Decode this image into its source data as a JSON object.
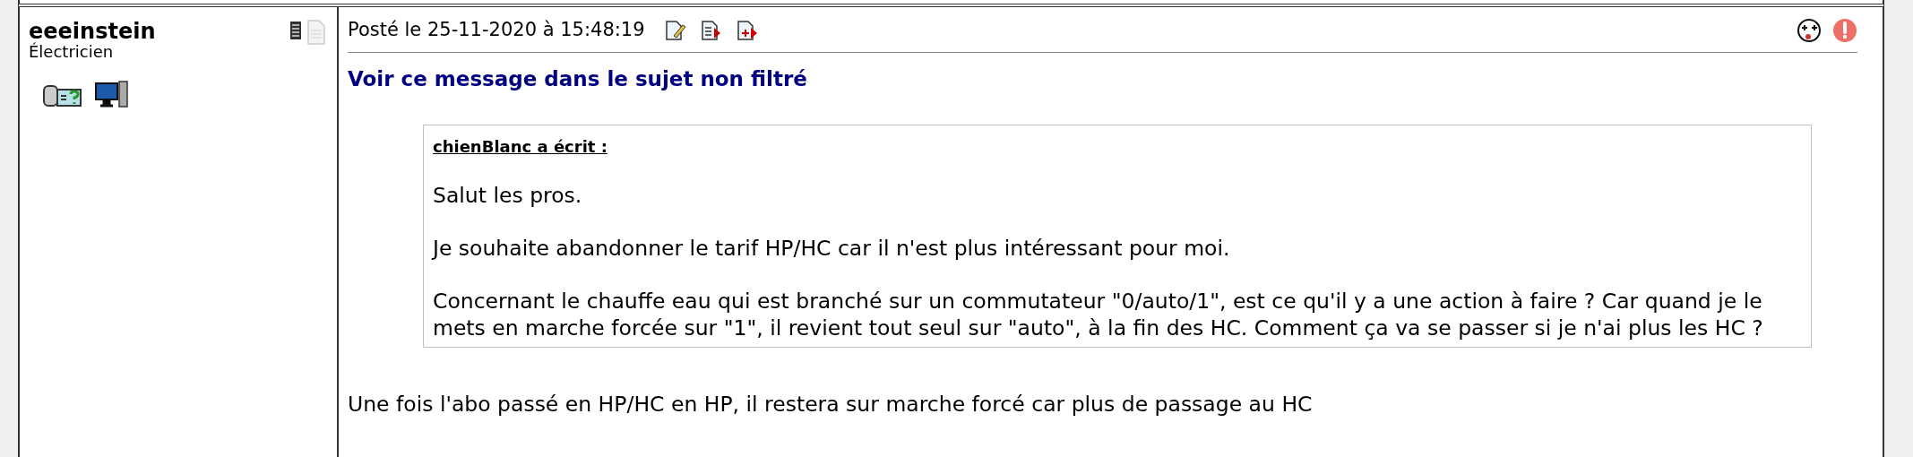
{
  "author": {
    "name": "eeeinstein",
    "role": "Électricien"
  },
  "post": {
    "posted": "Posté le 25-11-2020 à 15:48:19",
    "link": "Voir ce message dans le sujet non filtré",
    "quote": {
      "author": "chienBlanc a écrit :",
      "paragraphs": [
        "Salut les pros.",
        "Je souhaite abandonner le tarif HP/HC car il n'est plus intéressant pour moi.",
        "Concernant le chauffe eau qui est branché sur un commutateur \"0/auto/1\", est ce qu'il y a une action à faire ? Car quand je le mets en marche forcée sur \"1\", il revient tout seul sur \"auto\", à la fin des HC. Comment ça va se passer si je n'ai plus les HC ?"
      ]
    },
    "body": "Une fois l'abo passé en HP/HC en HP, il restera sur marche forcé car plus de passage au HC"
  }
}
